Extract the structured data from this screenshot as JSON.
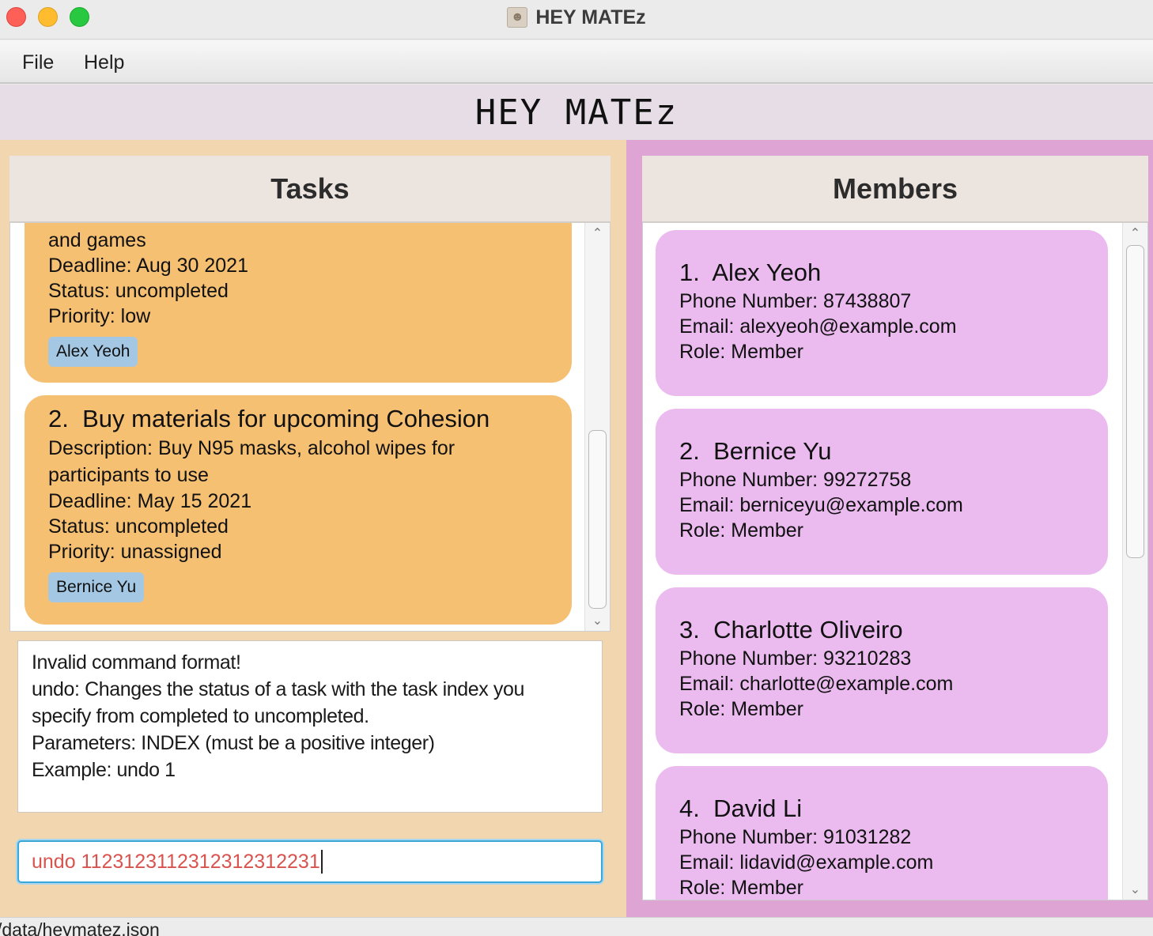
{
  "window": {
    "title": "HEY MATEz"
  },
  "menu": {
    "file": "File",
    "help": "Help"
  },
  "app_heading": "HEY MATEz",
  "tasks_panel": {
    "title": "Tasks",
    "items": [
      {
        "title_tail": "and games",
        "deadline": "Deadline: Aug 30 2021",
        "status": "Status: uncompleted",
        "priority": "Priority: low",
        "assignee": "Alex Yeoh"
      },
      {
        "index": "2.",
        "title": "Buy materials for upcoming Cohesion",
        "description_1": "Description: Buy N95 masks, alcohol wipes for",
        "description_2": "participants to use",
        "deadline": "Deadline: May 15 2021",
        "status": "Status: uncompleted",
        "priority": "Priority: unassigned",
        "assignee": "Bernice Yu"
      }
    ]
  },
  "result_display": {
    "lines": [
      "Invalid command format!",
      "undo: Changes the status of a task with the task index you",
      "specify from completed to uncompleted.",
      "Parameters: INDEX (must be a positive integer)",
      "Example: undo 1"
    ]
  },
  "command_box": {
    "value": "undo 1123123112312312312231"
  },
  "members_panel": {
    "title": "Members",
    "items": [
      {
        "index": "1.",
        "name": "Alex Yeoh",
        "phone": "Phone Number: 87438807",
        "email": "Email: alexyeoh@example.com",
        "role": "Role: Member"
      },
      {
        "index": "2.",
        "name": "Bernice Yu",
        "phone": "Phone Number: 99272758",
        "email": "Email: berniceyu@example.com",
        "role": "Role: Member"
      },
      {
        "index": "3.",
        "name": "Charlotte Oliveiro",
        "phone": "Phone Number: 93210283",
        "email": "Email: charlotte@example.com",
        "role": "Role: Member"
      },
      {
        "index": "4.",
        "name": "David Li",
        "phone": "Phone Number: 91031282",
        "email": "Email: lidavid@example.com",
        "role": "Role: Member"
      }
    ]
  },
  "status_bar": {
    "path": "/data/heymatez.json"
  },
  "colors": {
    "task_card": "#f6c073",
    "member_card": "#ebbbf0",
    "left_background": "#f1d6b0",
    "right_background": "#dea4d3",
    "tag": "#a4c8e3",
    "command_text": "#d9534f",
    "command_border": "#3aa7d6"
  },
  "icons": {
    "app": "contact-book-icon",
    "scroll_up": "chevron-up-icon",
    "scroll_down": "chevron-down-icon"
  }
}
